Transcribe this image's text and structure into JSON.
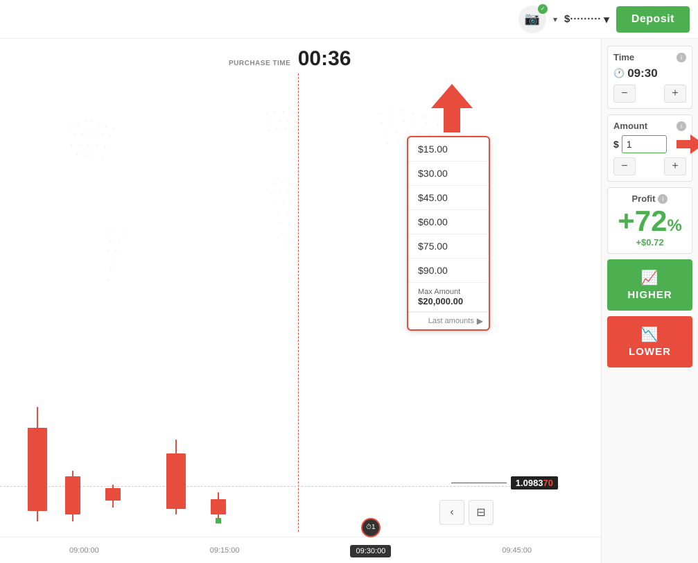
{
  "topbar": {
    "balance_display": "$·········",
    "deposit_label": "Deposit",
    "camera_label": "Screenshot"
  },
  "chart": {
    "purchase_time_label": "PURCHASE TIME",
    "purchase_time_value": "00:36",
    "price": "1.0983",
    "price_highlight": "70",
    "time_labels": [
      "09:00:00",
      "09:15:00",
      "09:30:00",
      "09:45:00"
    ],
    "timer_value": "1"
  },
  "amount_dropdown": {
    "items": [
      "$15.00",
      "$30.00",
      "$45.00",
      "$60.00",
      "$75.00",
      "$90.00"
    ],
    "max_label": "Max Amount",
    "max_value": "$20,000.00",
    "last_amounts_label": "Last amounts"
  },
  "right_panel": {
    "time_section": {
      "title": "Time",
      "value": "09:30",
      "minus_label": "−",
      "plus_label": "+"
    },
    "amount_section": {
      "title": "Amount",
      "dollar_sign": "$",
      "value": "1",
      "minus_label": "−",
      "plus_label": "+"
    },
    "profit_section": {
      "title": "Profit",
      "percent": "+72",
      "percent_symbol": "%",
      "amount": "+$0.72"
    },
    "higher_btn": "HIGHER",
    "lower_btn": "LOWER"
  },
  "icons": {
    "camera": "📷",
    "check": "✓",
    "clock": "🕐",
    "chevron_down": "▾",
    "arrow_down": "▼",
    "arrow_left": "◀",
    "back": "‹",
    "calculator": "⊞",
    "trending_up": "📈",
    "trending_down": "📉"
  }
}
